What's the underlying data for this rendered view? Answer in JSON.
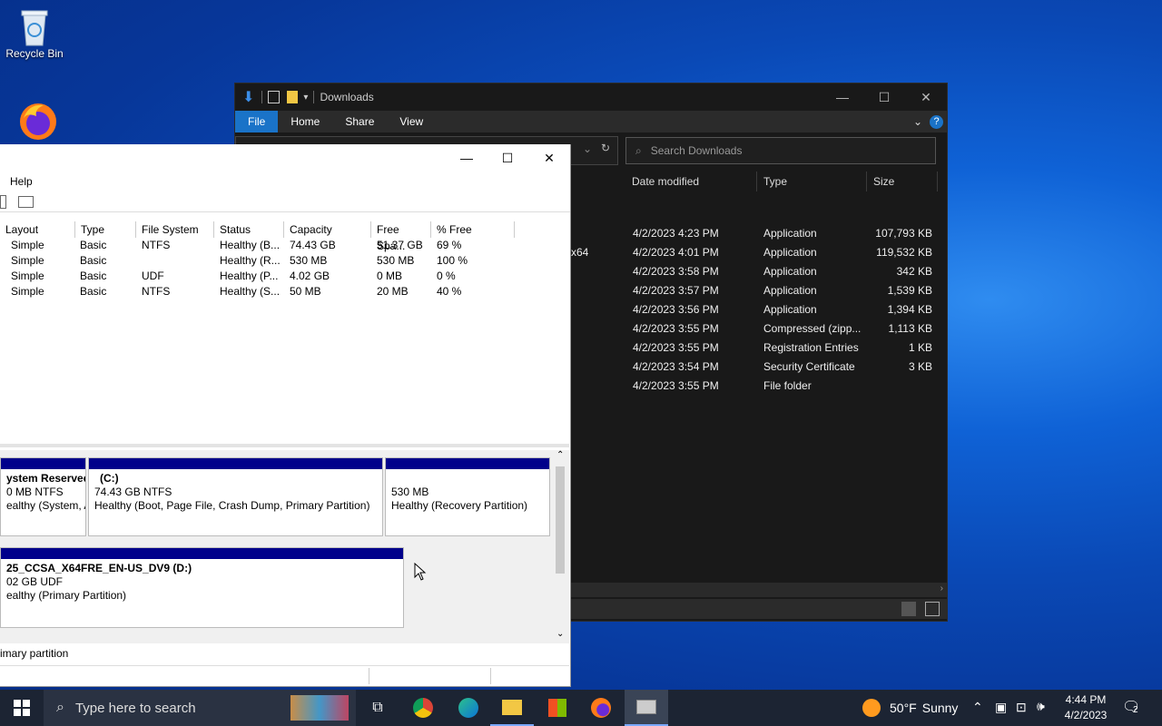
{
  "desktop": {
    "recycle_bin_label": "Recycle Bin",
    "firefox_label": ""
  },
  "explorer": {
    "title": "Downloads",
    "ribbon_tabs": [
      "File",
      "Home",
      "Share",
      "View"
    ],
    "search_placeholder": "Search Downloads",
    "columns": [
      "Date modified",
      "Type",
      "Size"
    ],
    "partial_name": "x64",
    "rows": [
      {
        "date": "4/2/2023 4:23 PM",
        "type": "Application",
        "size": "107,793 KB"
      },
      {
        "date": "4/2/2023 4:01 PM",
        "type": "Application",
        "size": "119,532 KB"
      },
      {
        "date": "4/2/2023 3:58 PM",
        "type": "Application",
        "size": "342 KB"
      },
      {
        "date": "4/2/2023 3:57 PM",
        "type": "Application",
        "size": "1,539 KB"
      },
      {
        "date": "4/2/2023 3:56 PM",
        "type": "Application",
        "size": "1,394 KB"
      },
      {
        "date": "4/2/2023 3:55 PM",
        "type": "Compressed (zipp...",
        "size": "1,113 KB"
      },
      {
        "date": "4/2/2023 3:55 PM",
        "type": "Registration Entries",
        "size": "1 KB"
      },
      {
        "date": "4/2/2023 3:54 PM",
        "type": "Security Certificate",
        "size": "3 KB"
      },
      {
        "date": "4/2/2023 3:55 PM",
        "type": "File folder",
        "size": ""
      }
    ]
  },
  "diskmgmt": {
    "menu_help": "Help",
    "columns": [
      "Layout",
      "Type",
      "File System",
      "Status",
      "Capacity",
      "Free Spa...",
      "% Free"
    ],
    "volumes": [
      {
        "layout": "Simple",
        "type": "Basic",
        "fs": "NTFS",
        "status": "Healthy (B...",
        "capacity": "74.43 GB",
        "free": "51.37 GB",
        "pct": "69 %"
      },
      {
        "layout": "Simple",
        "type": "Basic",
        "fs": "",
        "status": "Healthy (R...",
        "capacity": "530 MB",
        "free": "530 MB",
        "pct": "100 %"
      },
      {
        "layout": "Simple",
        "type": "Basic",
        "fs": "UDF",
        "status": "Healthy (P...",
        "capacity": "4.02 GB",
        "free": "0 MB",
        "pct": "0 %"
      },
      {
        "layout": "Simple",
        "type": "Basic",
        "fs": "NTFS",
        "status": "Healthy (S...",
        "capacity": "50 MB",
        "free": "20 MB",
        "pct": "40 %"
      }
    ],
    "disk0": {
      "p1": {
        "name": "ystem Reserved",
        "size": "0 MB NTFS",
        "status": "ealthy (System, A"
      },
      "p2": {
        "name": "(C:)",
        "size": "74.43 GB NTFS",
        "status": "Healthy (Boot, Page File, Crash Dump, Primary Partition)"
      },
      "p3": {
        "size": "530 MB",
        "status": "Healthy (Recovery Partition)"
      }
    },
    "disk1": {
      "p1": {
        "name": "25_CCSA_X64FRE_EN-US_DV9  (D:)",
        "size": "02 GB UDF",
        "status": "ealthy (Primary Partition)"
      }
    },
    "legend": "imary partition"
  },
  "taskbar": {
    "search_placeholder": "Type here to search",
    "weather_temp": "50°F",
    "weather_text": "Sunny",
    "time": "4:44 PM",
    "date": "4/2/2023",
    "notification_count": "2"
  }
}
